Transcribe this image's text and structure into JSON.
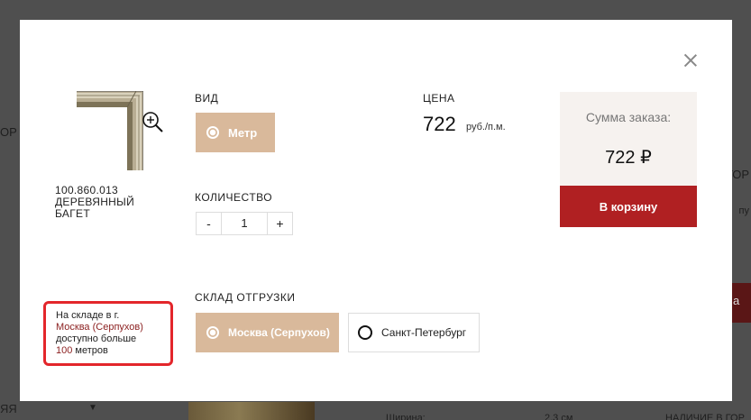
{
  "background": {
    "left_fragment": "ОР",
    "right_fragment": "ГОР",
    "right_fragment2": "пу",
    "red_button_fragment": "а",
    "bottom_left": "ЯЯ",
    "bottom_mid": "Ширина:",
    "bottom_num": "2,3 см",
    "bottom_right": "НАЛИЧИЕ В ГОР"
  },
  "product": {
    "code": "100.860.013",
    "name": "ДЕРЕВЯННЫЙ БАГЕТ"
  },
  "view": {
    "label": "ВИД",
    "option": "Метр"
  },
  "price": {
    "label": "ЦЕНА",
    "value": "722",
    "unit": "руб./п.м."
  },
  "quantity": {
    "label": "КОЛИЧЕСТВО",
    "minus": "-",
    "value": "1",
    "plus": "+"
  },
  "warehouse": {
    "label": "СКЛАД ОТГРУЗКИ",
    "options": [
      "Москва (Серпухов)",
      "Санкт-Петербург"
    ],
    "selected": "Москва (Серпухов)"
  },
  "order": {
    "sum_label": "Сумма заказа:",
    "sum_value": "722 ₽",
    "cart_button": "В корзину"
  },
  "stock_note": {
    "prefix": "На складе в г.",
    "city": "Москва (Серпухов)",
    "middle": "доступно больше",
    "amount": "100",
    "suffix": "метров"
  },
  "colors": {
    "accent_beige": "#d9b99b",
    "cart_red": "#b02022",
    "highlight_red": "#e3262b",
    "overlay": "#4f4f4f"
  }
}
